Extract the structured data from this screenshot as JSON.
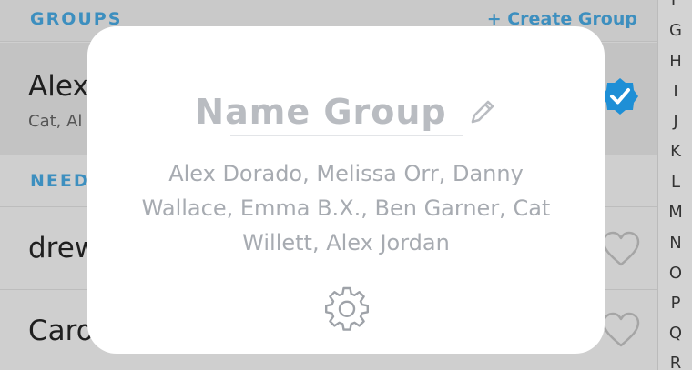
{
  "groups_section": {
    "title": "GROUPS",
    "create_label": "+ Create Group"
  },
  "selected_group": {
    "name": "Alex",
    "subtitle": "Cat, Al"
  },
  "need_section": {
    "title": "NEED"
  },
  "rows": [
    {
      "name": "drew"
    },
    {
      "name": "Caro"
    }
  ],
  "alphabet": [
    "F",
    "G",
    "H",
    "I",
    "J",
    "K",
    "L",
    "M",
    "N",
    "O",
    "P",
    "Q",
    "R"
  ],
  "modal": {
    "title": "Name Group",
    "members": "Alex Dorado, Melissa Orr, Danny Wallace, Emma B.X., Ben Garner, Cat Willett, Alex Jordan"
  },
  "colors": {
    "accent": "#3d8fbf",
    "check": "#1e8fd6",
    "modal_text": "#b9bcc1"
  },
  "icons": {
    "edit": "pencil-icon",
    "settings": "gear-icon",
    "selected": "check-badge-icon",
    "favorite": "heart-icon"
  }
}
